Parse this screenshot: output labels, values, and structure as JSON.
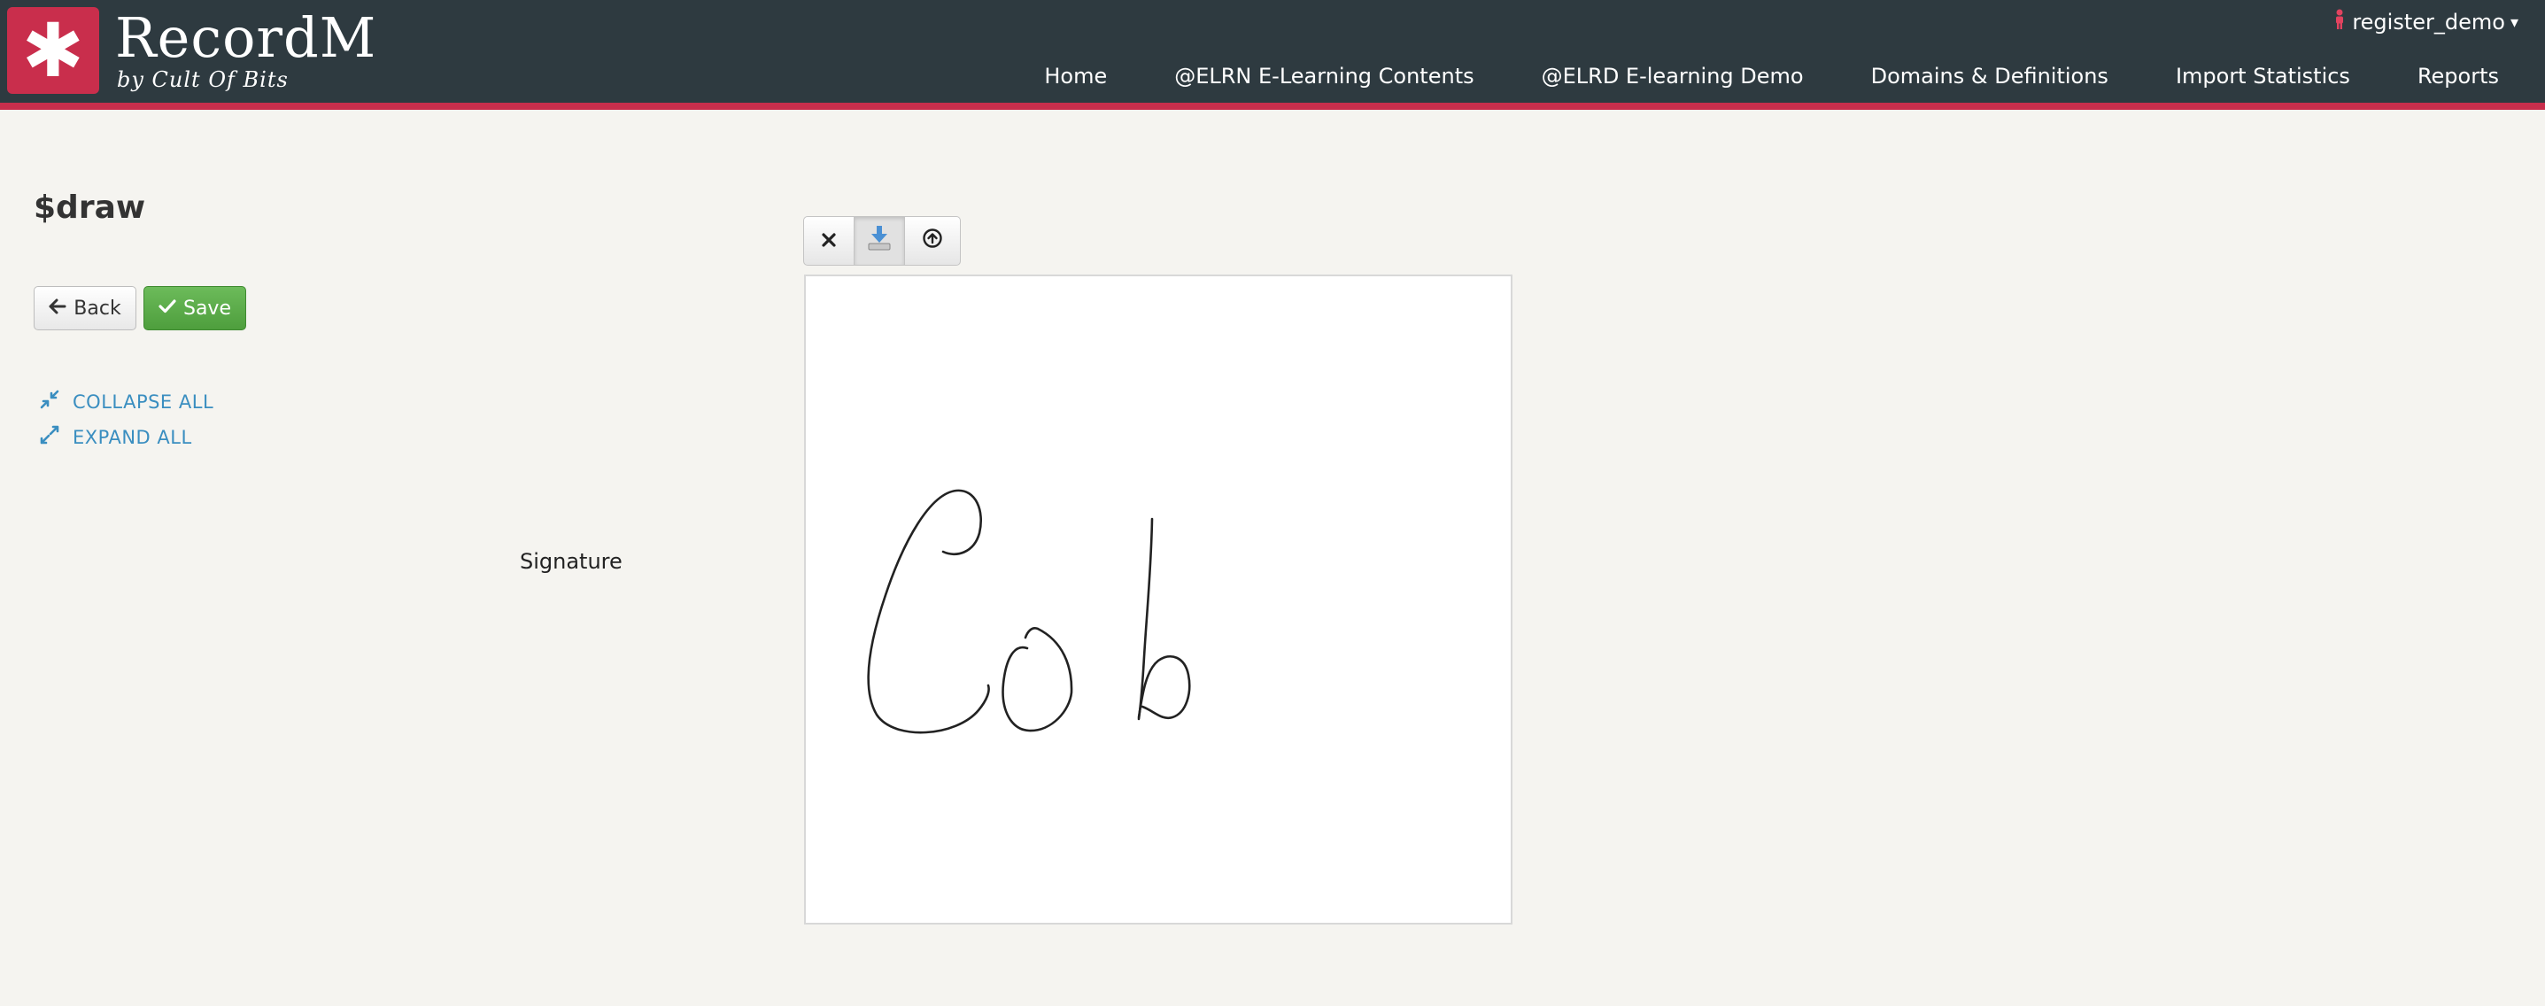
{
  "app": {
    "brand": "RecordM",
    "tagline": "by Cult Of Bits",
    "logo_glyph": "✱",
    "accent_color": "#c92e4c",
    "header_color": "#2e3a40"
  },
  "user": {
    "name": "register_demo",
    "icon": "user-icon",
    "caret": "▾"
  },
  "nav": {
    "items": [
      {
        "label": "Home"
      },
      {
        "label": "@ELRN E-Learning Contents"
      },
      {
        "label": "@ELRD E-learning Demo"
      },
      {
        "label": "Domains & Definitions"
      },
      {
        "label": "Import Statistics"
      },
      {
        "label": "Reports"
      }
    ]
  },
  "page": {
    "title": "$draw",
    "back_label": "Back",
    "save_label": "Save",
    "save_color": "#5cb04a",
    "collapse_all": "COLLAPSE ALL",
    "expand_all": "EXPAND ALL",
    "link_color": "#3a8ec0"
  },
  "field": {
    "label": "Signature",
    "tools": [
      {
        "name": "clear-icon",
        "glyph": "✕"
      },
      {
        "name": "download-icon",
        "glyph": "⤓"
      },
      {
        "name": "upload-icon",
        "glyph": "⇧"
      }
    ]
  }
}
